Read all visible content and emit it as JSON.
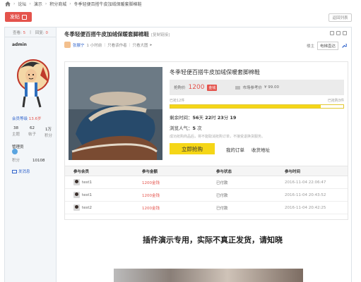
{
  "breadcrumb": [
    "论坛",
    "演示",
    "积分商城",
    "冬季轻便百搭牛皮加绒保暖套脚棉鞋"
  ],
  "buttons": {
    "post": "发帖",
    "back": "返回列表"
  },
  "sidebar": {
    "views_label": "查看:",
    "views": "5",
    "replies_label": "回复:",
    "replies": "0",
    "author": "admin",
    "group": "会员等级",
    "group_points": "13.6岁",
    "stats": [
      {
        "num": "38",
        "label": "主题"
      },
      {
        "num": "62",
        "label": "帖子"
      },
      {
        "num": "1万",
        "label": "积分"
      }
    ],
    "role": "管理员",
    "points_label": "积分",
    "points": "10108",
    "pm": "发消息"
  },
  "post": {
    "title": "冬季轻便百搭牛皮加绒保暖套脚棉鞋",
    "copy_link": "[复制链接]",
    "author": "发表于",
    "author_name": "张展宁",
    "time": "1 小时前",
    "only_author": "只看该作者",
    "only_big": "只看大图",
    "order_label": "楼主",
    "order_select": "电梯直达"
  },
  "product": {
    "name": "冬季轻便百搭牛皮加绒保暖套脚棉鞋",
    "price_label": "抢购价",
    "price": "1200",
    "price_unit": "金钱",
    "market_label": "市场参考价",
    "market_price": "¥ 99.00",
    "sold_label": "已抢12件",
    "remain_stock": "已抢购3件",
    "progress": 0.87,
    "remain_prefix": "剩余时间：",
    "remain_days": "56",
    "remain_days_unit": "天",
    "remain_hours": "22",
    "remain_hours_unit": "时",
    "remain_mins": "23",
    "remain_mins_unit": "分",
    "remain_secs": "19",
    "views_prefix": "浏览人气：",
    "views": "5",
    "views_unit": "次",
    "notice": "成功抢购商品后，将不能取消抢购订单，不接受退换货服务。",
    "buy": "立即抢购",
    "my_orders": "我的订单",
    "address": "收货地址"
  },
  "records": {
    "headers": [
      "参与会员",
      "参与金额",
      "参与状态",
      "参与时间"
    ],
    "rows": [
      {
        "user": "test1",
        "amount": "1200金钱",
        "status": "已付款",
        "time": "2016-11-04 22:06:47"
      },
      {
        "user": "test1",
        "amount": "1200金钱",
        "status": "已付款",
        "time": "2016-11-04 20:43:52"
      },
      {
        "user": "test2",
        "amount": "1200金钱",
        "status": "已付款",
        "time": "2016-11-04 20:42:25"
      }
    ]
  },
  "headline": "插件演示专用，实际不真正发货，请知晓",
  "colors": {
    "accent": "#e4534c",
    "buy": "#f5d617",
    "link": "#3366cc"
  }
}
